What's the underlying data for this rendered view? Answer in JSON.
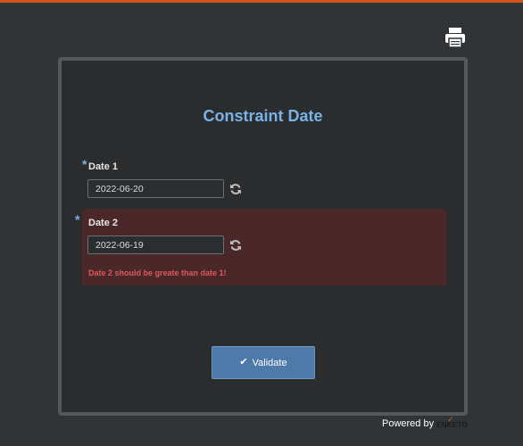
{
  "app": {
    "accent_color": "#d0541b"
  },
  "toolbar": {
    "print_icon": "print-icon"
  },
  "form": {
    "title": "Constraint Date",
    "questions": [
      {
        "required_marker": "*",
        "label": "Date 1",
        "value": "2022-06-20",
        "reset_icon": "refresh-icon"
      },
      {
        "required_marker": "*",
        "label": "Date 2",
        "value": "2022-06-19",
        "reset_icon": "refresh-icon",
        "error": "Date 2 should be greate than date 1!",
        "error_color": "#e0585b",
        "invalid_bg": "#4a2728"
      }
    ],
    "validate_label": "Validate",
    "validate_icon": "check-icon"
  },
  "footer": {
    "powered_by": "Powered by",
    "brand": "ENKETO"
  }
}
